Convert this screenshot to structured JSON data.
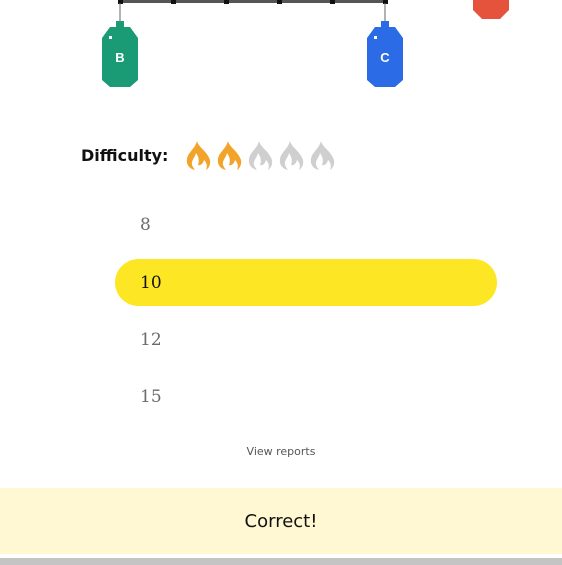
{
  "diagram": {
    "weights": [
      {
        "label": "B",
        "color": "#1b9a76"
      },
      {
        "label": "C",
        "color": "#2b6be6"
      }
    ],
    "partial_weight_color": "#e5533d"
  },
  "difficulty": {
    "label": "Difficulty:",
    "level": 2,
    "max": 5,
    "active_color": "#f2a42a",
    "inactive_color": "#cfcfcf"
  },
  "options": [
    {
      "value": "8",
      "selected": false
    },
    {
      "value": "10",
      "selected": true
    },
    {
      "value": "12",
      "selected": false
    },
    {
      "value": "15",
      "selected": false
    }
  ],
  "view_reports": "View reports",
  "feedback": "Correct!"
}
